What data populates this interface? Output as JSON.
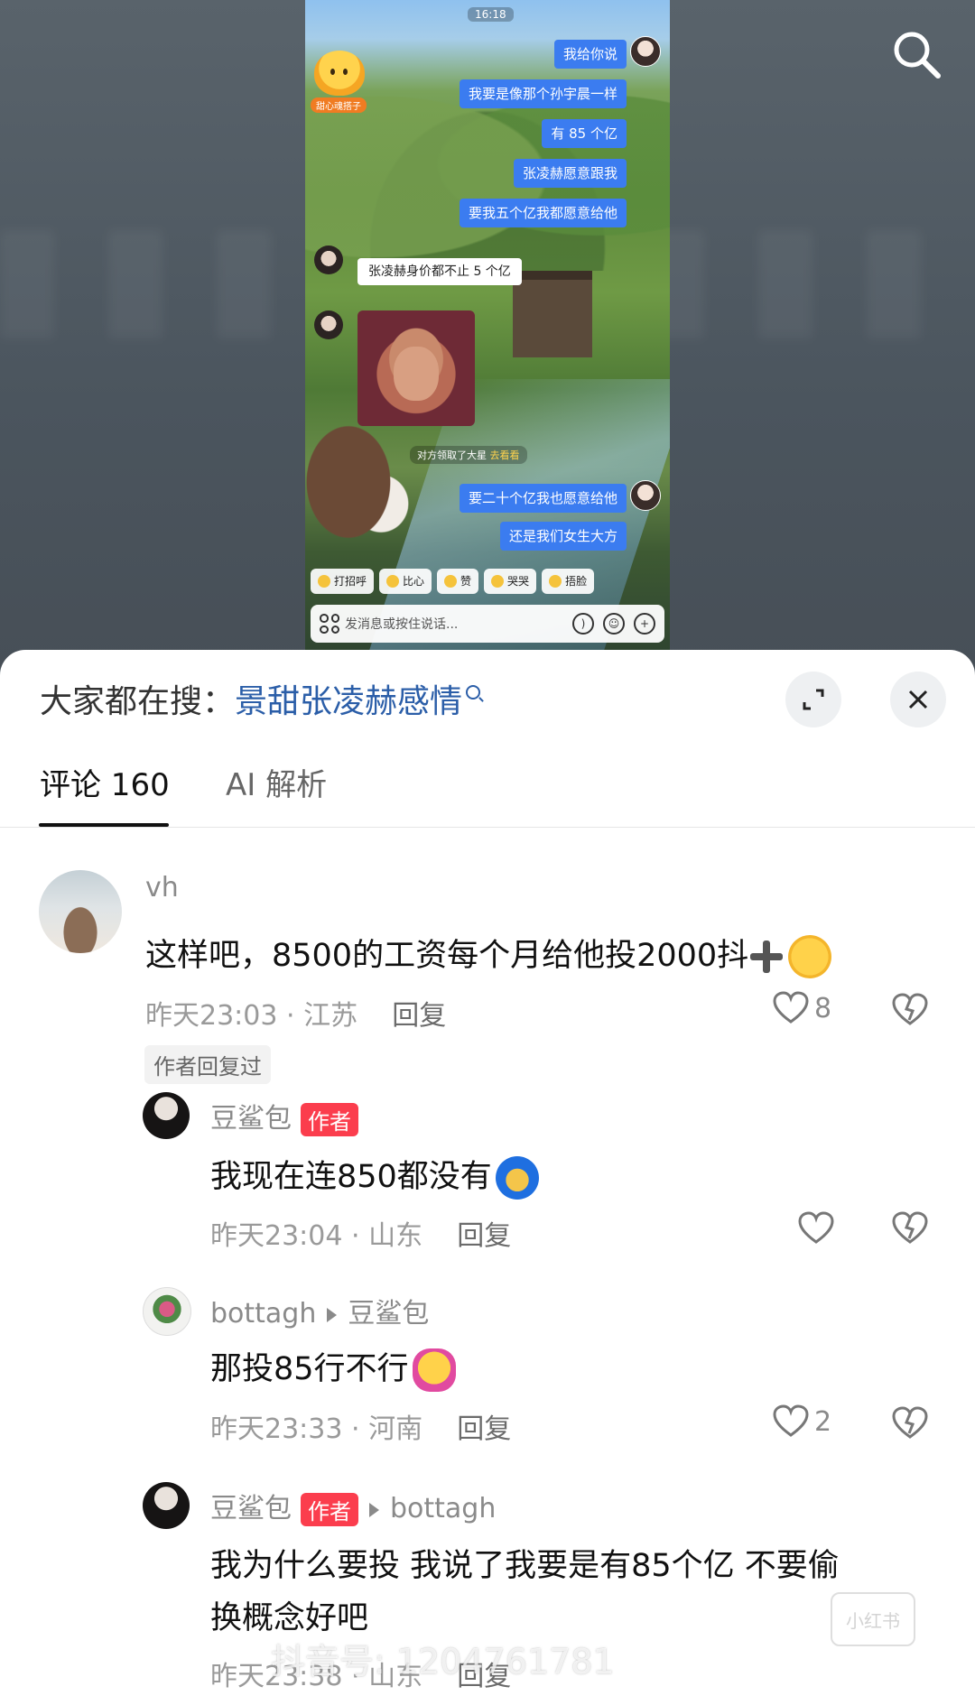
{
  "video": {
    "status_time": "16:18",
    "mascot_label": "甜心魂搭子",
    "chat": {
      "me_messages": [
        "我给你说",
        "我要是像那个孙宇晨一样",
        "有 85 个亿",
        "张凌赫愿意跟我",
        "要我五个亿我都愿意给他"
      ],
      "other_message": "张凌赫身价都不止 5 个亿",
      "system_note_prefix": "对方领取了大星",
      "system_note_highlight": "去看看",
      "me_messages_2": [
        "要二十个亿我也愿意给他",
        "还是我们女生大方"
      ]
    },
    "quick_replies": [
      "打招呼",
      "比心",
      "赞",
      "哭哭",
      "捂脸"
    ],
    "input_placeholder": "发消息或按住说话..."
  },
  "sheet": {
    "search_prefix": "大家都在搜：",
    "search_keyword": "景甜张凌赫感情",
    "tabs": [
      {
        "label": "评论 160"
      },
      {
        "label": "AI 解析"
      }
    ]
  },
  "comments": {
    "main": {
      "user": "vh",
      "text": "这样吧，8500的工资每个月给他投2000抖",
      "time": "昨天23:03",
      "location": "· 江苏",
      "reply": "回复",
      "likes": "8",
      "author_replied": "作者回复过"
    },
    "replies": [
      {
        "user": "豆鲨包",
        "author_tag": "作者",
        "text": "我现在连850都没有",
        "time": "昨天23:04",
        "location": "· 山东",
        "reply": "回复",
        "likes": ""
      },
      {
        "user": "bottagh",
        "reply_to": "豆鲨包",
        "text": "那投85行不行",
        "time": "昨天23:33",
        "location": "· 河南",
        "reply": "回复",
        "likes": "2"
      },
      {
        "user": "豆鲨包",
        "author_tag": "作者",
        "reply_to": "bottagh",
        "text_line1": "我为什么要投 我说了我要是有85个亿 不要偷",
        "text_line2": "换概念好吧",
        "time": "昨天23:38",
        "location": "· 山东",
        "reply": "回复"
      }
    ]
  },
  "watermark": {
    "text": "抖音号: 1204761781",
    "badge": "小红书"
  },
  "colors": {
    "accent_blue": "#3b7cf0",
    "keyword_blue": "#2b5ea8",
    "author_red": "#fb3d4d"
  }
}
